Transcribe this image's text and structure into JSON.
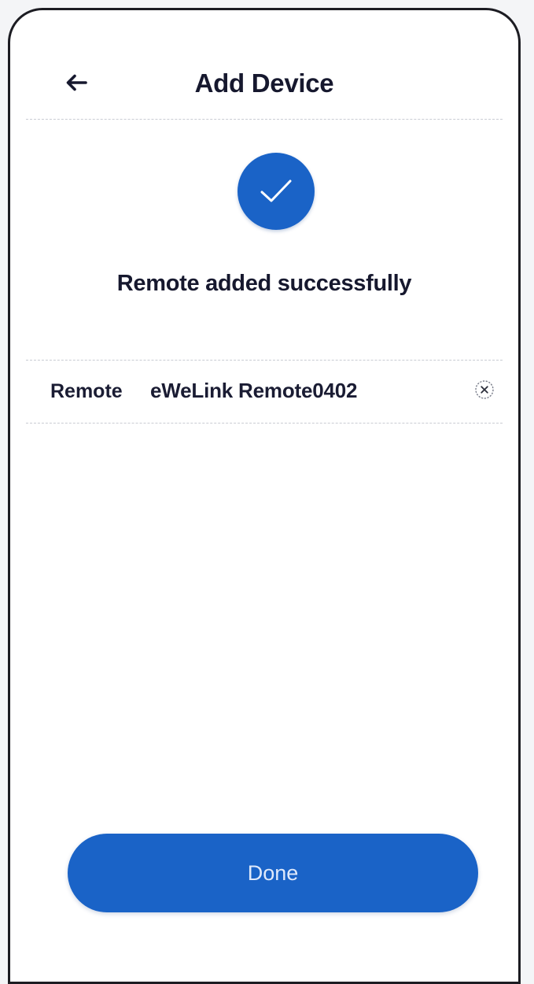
{
  "header": {
    "title": "Add Device",
    "back_icon": "arrow-left-icon"
  },
  "success": {
    "icon": "check-circle-icon",
    "message": "Remote added successfully"
  },
  "device": {
    "type_label": "Remote",
    "name_value": "eWeLink Remote0402",
    "clear_icon": "clear-x-icon"
  },
  "footer": {
    "done_label": "Done"
  },
  "colors": {
    "accent": "#1a63c7",
    "text": "#16182e",
    "background": "#ffffff"
  }
}
